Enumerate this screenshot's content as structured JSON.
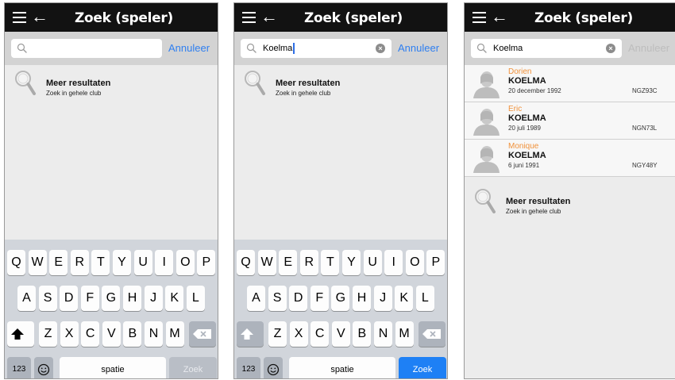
{
  "screens": [
    {
      "title": "Zoek (speler)",
      "search": {
        "value": "",
        "has_caret": false,
        "has_clear": false
      },
      "cancel": {
        "label": "Annuleer",
        "enabled": true
      },
      "results": [],
      "more": {
        "title": "Meer resultaten",
        "subtitle": "Zoek in gehele club"
      },
      "keyboard": {
        "row1": [
          "Q",
          "W",
          "E",
          "R",
          "T",
          "Y",
          "U",
          "I",
          "O",
          "P"
        ],
        "row2": [
          "A",
          "S",
          "D",
          "F",
          "G",
          "H",
          "J",
          "K",
          "L"
        ],
        "row3": [
          "Z",
          "X",
          "C",
          "V",
          "B",
          "N",
          "M"
        ],
        "numbers": "123",
        "space": "spatie",
        "go": "Zoek",
        "go_active": false,
        "shift_active": true
      }
    },
    {
      "title": "Zoek (speler)",
      "search": {
        "value": "Koelma",
        "has_caret": true,
        "has_clear": true
      },
      "cancel": {
        "label": "Annuleer",
        "enabled": true
      },
      "results": [],
      "more": {
        "title": "Meer resultaten",
        "subtitle": "Zoek in gehele club"
      },
      "keyboard": {
        "row1": [
          "Q",
          "W",
          "E",
          "R",
          "T",
          "Y",
          "U",
          "I",
          "O",
          "P"
        ],
        "row2": [
          "A",
          "S",
          "D",
          "F",
          "G",
          "H",
          "J",
          "K",
          "L"
        ],
        "row3": [
          "Z",
          "X",
          "C",
          "V",
          "B",
          "N",
          "M"
        ],
        "numbers": "123",
        "space": "spatie",
        "go": "Zoek",
        "go_active": true,
        "shift_active": false
      }
    },
    {
      "title": "Zoek (speler)",
      "search": {
        "value": "Koelma",
        "has_caret": false,
        "has_clear": true
      },
      "cancel": {
        "label": "Annuleer",
        "enabled": false
      },
      "results": [
        {
          "first": "Dorien",
          "last": "KOELMA",
          "dob": "20 december 1992",
          "code": "NGZ93C"
        },
        {
          "first": "Eric",
          "last": "KOELMA",
          "dob": "20 juli 1989",
          "code": "NGN73L"
        },
        {
          "first": "Monique",
          "last": "KOELMA",
          "dob": "6 juni 1991",
          "code": "NGY48Y"
        }
      ],
      "more": {
        "title": "Meer resultaten",
        "subtitle": "Zoek in gehele club"
      },
      "keyboard": null
    }
  ],
  "colors": {
    "nav": "#121212",
    "accent": "#2f7ff0",
    "first_name": "#f0913a",
    "keyboard": "#d1d5db"
  },
  "icons": {
    "menu": "hamburger-icon",
    "back": "back-arrow-icon",
    "search": "magnifier-icon",
    "clear": "clear-x-icon",
    "avatar": "person-silhouette-icon",
    "shift": "shift-arrow-icon",
    "delete": "backspace-icon",
    "emoji": "emoji-icon"
  }
}
